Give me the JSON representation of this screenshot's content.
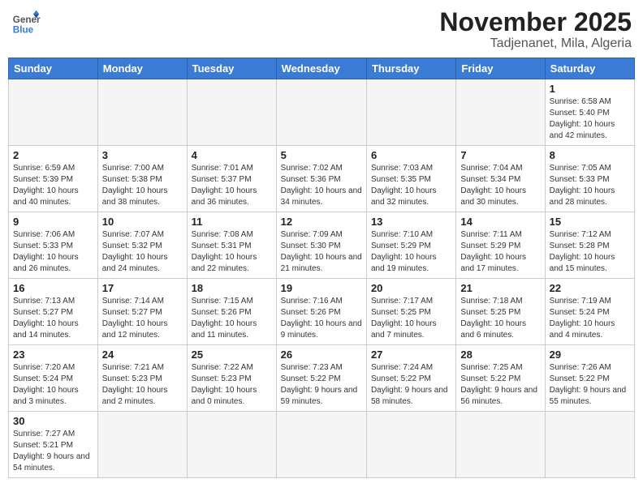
{
  "logo": {
    "text_general": "General",
    "text_blue": "Blue"
  },
  "header": {
    "month": "November 2025",
    "location": "Tadjenanet, Mila, Algeria"
  },
  "days_of_week": [
    "Sunday",
    "Monday",
    "Tuesday",
    "Wednesday",
    "Thursday",
    "Friday",
    "Saturday"
  ],
  "weeks": [
    [
      {
        "day": "",
        "info": ""
      },
      {
        "day": "",
        "info": ""
      },
      {
        "day": "",
        "info": ""
      },
      {
        "day": "",
        "info": ""
      },
      {
        "day": "",
        "info": ""
      },
      {
        "day": "",
        "info": ""
      },
      {
        "day": "1",
        "info": "Sunrise: 6:58 AM\nSunset: 5:40 PM\nDaylight: 10 hours and 42 minutes."
      }
    ],
    [
      {
        "day": "2",
        "info": "Sunrise: 6:59 AM\nSunset: 5:39 PM\nDaylight: 10 hours and 40 minutes."
      },
      {
        "day": "3",
        "info": "Sunrise: 7:00 AM\nSunset: 5:38 PM\nDaylight: 10 hours and 38 minutes."
      },
      {
        "day": "4",
        "info": "Sunrise: 7:01 AM\nSunset: 5:37 PM\nDaylight: 10 hours and 36 minutes."
      },
      {
        "day": "5",
        "info": "Sunrise: 7:02 AM\nSunset: 5:36 PM\nDaylight: 10 hours and 34 minutes."
      },
      {
        "day": "6",
        "info": "Sunrise: 7:03 AM\nSunset: 5:35 PM\nDaylight: 10 hours and 32 minutes."
      },
      {
        "day": "7",
        "info": "Sunrise: 7:04 AM\nSunset: 5:34 PM\nDaylight: 10 hours and 30 minutes."
      },
      {
        "day": "8",
        "info": "Sunrise: 7:05 AM\nSunset: 5:33 PM\nDaylight: 10 hours and 28 minutes."
      }
    ],
    [
      {
        "day": "9",
        "info": "Sunrise: 7:06 AM\nSunset: 5:33 PM\nDaylight: 10 hours and 26 minutes."
      },
      {
        "day": "10",
        "info": "Sunrise: 7:07 AM\nSunset: 5:32 PM\nDaylight: 10 hours and 24 minutes."
      },
      {
        "day": "11",
        "info": "Sunrise: 7:08 AM\nSunset: 5:31 PM\nDaylight: 10 hours and 22 minutes."
      },
      {
        "day": "12",
        "info": "Sunrise: 7:09 AM\nSunset: 5:30 PM\nDaylight: 10 hours and 21 minutes."
      },
      {
        "day": "13",
        "info": "Sunrise: 7:10 AM\nSunset: 5:29 PM\nDaylight: 10 hours and 19 minutes."
      },
      {
        "day": "14",
        "info": "Sunrise: 7:11 AM\nSunset: 5:29 PM\nDaylight: 10 hours and 17 minutes."
      },
      {
        "day": "15",
        "info": "Sunrise: 7:12 AM\nSunset: 5:28 PM\nDaylight: 10 hours and 15 minutes."
      }
    ],
    [
      {
        "day": "16",
        "info": "Sunrise: 7:13 AM\nSunset: 5:27 PM\nDaylight: 10 hours and 14 minutes."
      },
      {
        "day": "17",
        "info": "Sunrise: 7:14 AM\nSunset: 5:27 PM\nDaylight: 10 hours and 12 minutes."
      },
      {
        "day": "18",
        "info": "Sunrise: 7:15 AM\nSunset: 5:26 PM\nDaylight: 10 hours and 11 minutes."
      },
      {
        "day": "19",
        "info": "Sunrise: 7:16 AM\nSunset: 5:26 PM\nDaylight: 10 hours and 9 minutes."
      },
      {
        "day": "20",
        "info": "Sunrise: 7:17 AM\nSunset: 5:25 PM\nDaylight: 10 hours and 7 minutes."
      },
      {
        "day": "21",
        "info": "Sunrise: 7:18 AM\nSunset: 5:25 PM\nDaylight: 10 hours and 6 minutes."
      },
      {
        "day": "22",
        "info": "Sunrise: 7:19 AM\nSunset: 5:24 PM\nDaylight: 10 hours and 4 minutes."
      }
    ],
    [
      {
        "day": "23",
        "info": "Sunrise: 7:20 AM\nSunset: 5:24 PM\nDaylight: 10 hours and 3 minutes."
      },
      {
        "day": "24",
        "info": "Sunrise: 7:21 AM\nSunset: 5:23 PM\nDaylight: 10 hours and 2 minutes."
      },
      {
        "day": "25",
        "info": "Sunrise: 7:22 AM\nSunset: 5:23 PM\nDaylight: 10 hours and 0 minutes."
      },
      {
        "day": "26",
        "info": "Sunrise: 7:23 AM\nSunset: 5:22 PM\nDaylight: 9 hours and 59 minutes."
      },
      {
        "day": "27",
        "info": "Sunrise: 7:24 AM\nSunset: 5:22 PM\nDaylight: 9 hours and 58 minutes."
      },
      {
        "day": "28",
        "info": "Sunrise: 7:25 AM\nSunset: 5:22 PM\nDaylight: 9 hours and 56 minutes."
      },
      {
        "day": "29",
        "info": "Sunrise: 7:26 AM\nSunset: 5:22 PM\nDaylight: 9 hours and 55 minutes."
      }
    ],
    [
      {
        "day": "30",
        "info": "Sunrise: 7:27 AM\nSunset: 5:21 PM\nDaylight: 9 hours and 54 minutes."
      },
      {
        "day": "",
        "info": ""
      },
      {
        "day": "",
        "info": ""
      },
      {
        "day": "",
        "info": ""
      },
      {
        "day": "",
        "info": ""
      },
      {
        "day": "",
        "info": ""
      },
      {
        "day": "",
        "info": ""
      }
    ]
  ]
}
